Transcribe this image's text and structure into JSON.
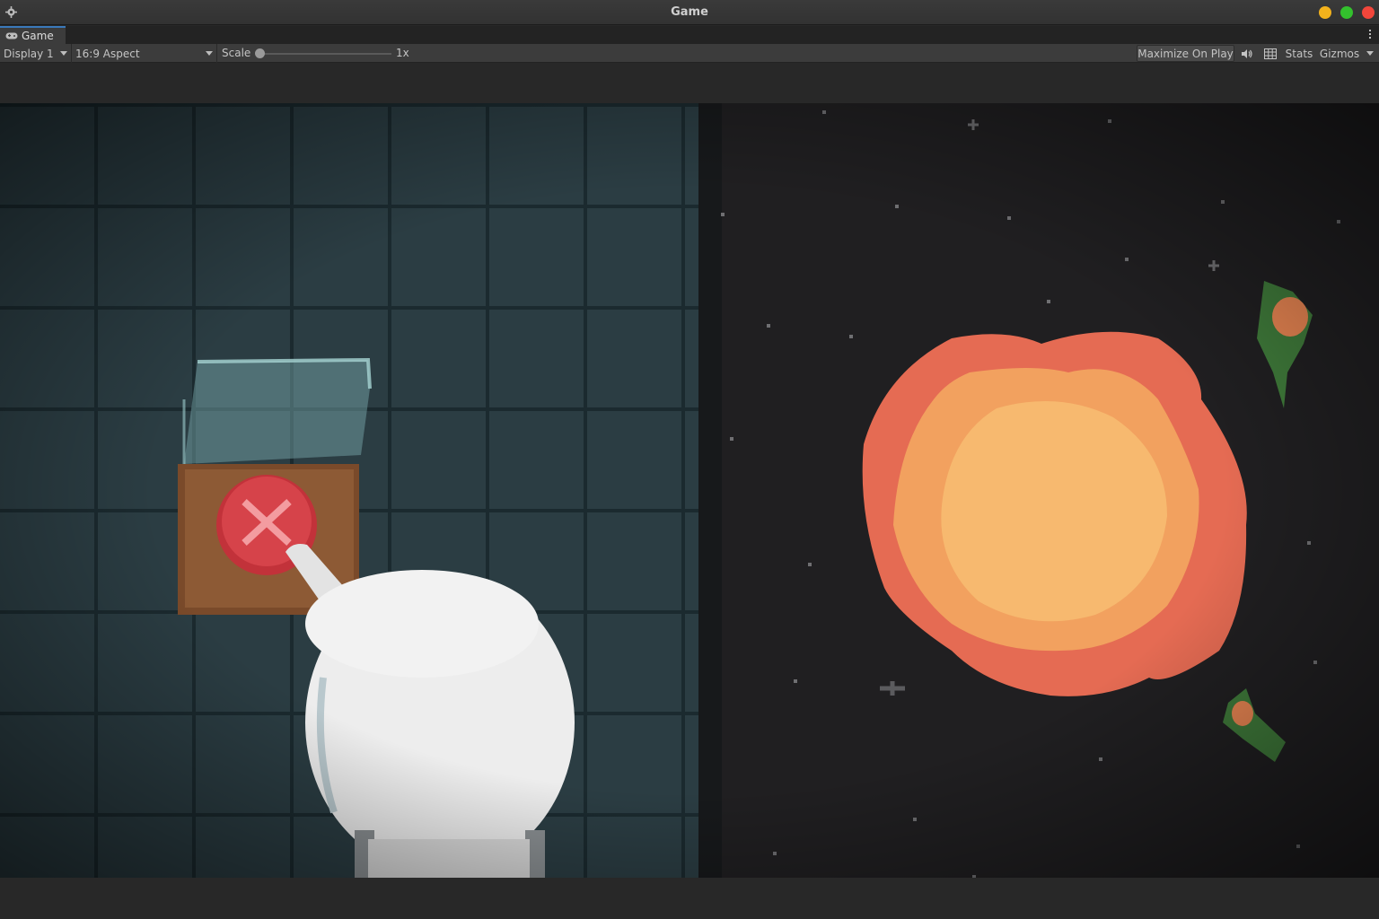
{
  "window": {
    "title": "Game",
    "icons": {
      "settings": "gear-icon"
    },
    "controls": {
      "minimize_color": "#f3b21c",
      "maximize_color": "#33c12d",
      "close_color": "#f2463b"
    }
  },
  "tabs": [
    {
      "label": "Game",
      "icon": "gamepad-icon",
      "active": true
    }
  ],
  "toolbar": {
    "display": "Display 1",
    "aspect": "16:9 Aspect",
    "scale_label": "Scale",
    "scale_value": "1x",
    "maximize_on_play": "Maximize On Play",
    "audio_icon": "speaker-icon",
    "grid_icon": "grid-icon",
    "stats": "Stats",
    "gizmos": "Gizmos"
  },
  "scene": {
    "left_panel": "tiled-wall with astronaut pressing red button",
    "right_panel": "space explosion",
    "accent_colors": {
      "tile": "#2b3d43",
      "button": "#cf3c44",
      "explosion_outer": "#e66c52",
      "explosion_inner": "#f5b566"
    }
  }
}
